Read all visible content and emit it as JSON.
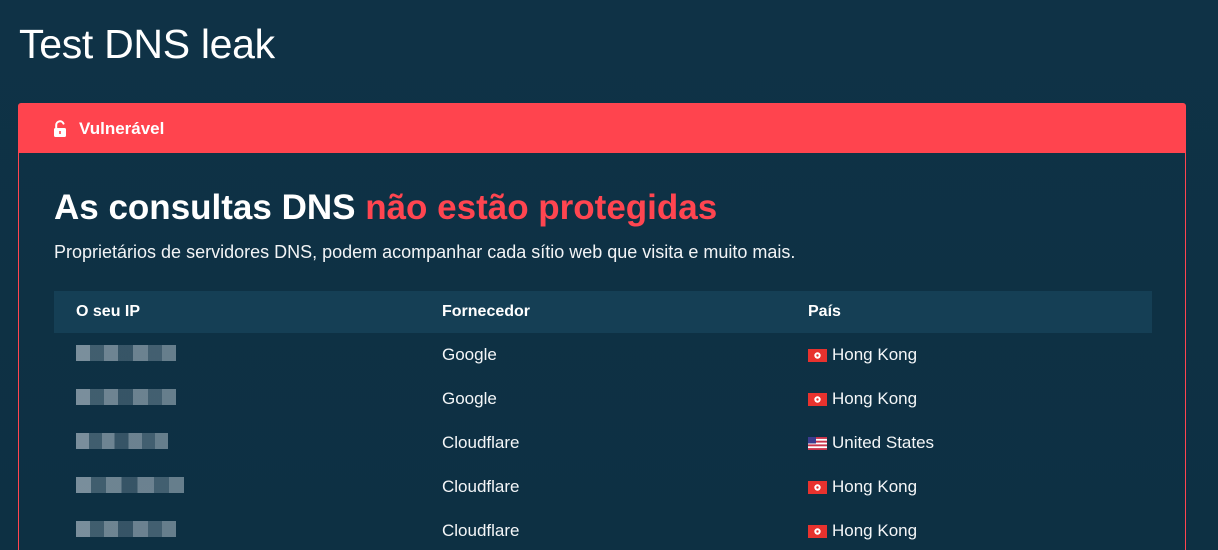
{
  "page": {
    "title": "Test DNS leak"
  },
  "status": {
    "label": "Vulnerável",
    "icon": "unlocked-padlock-icon",
    "color": "#ff444e"
  },
  "headline": {
    "part1": "As consultas DNS ",
    "part2": "não estão protegidas"
  },
  "subtext": "Proprietários de servidores DNS, podem acompanhar cada sítio web que visita e muito mais.",
  "table": {
    "headers": {
      "ip": "O seu IP",
      "provider": "Fornecedor",
      "country": "País"
    },
    "rows": [
      {
        "provider": "Google",
        "country": "Hong Kong",
        "flag": "hong-kong-flag-icon"
      },
      {
        "provider": "Google",
        "country": "Hong Kong",
        "flag": "hong-kong-flag-icon"
      },
      {
        "provider": "Cloudflare",
        "country": "United States",
        "flag": "united-states-flag-icon"
      },
      {
        "provider": "Cloudflare",
        "country": "Hong Kong",
        "flag": "hong-kong-flag-icon"
      },
      {
        "provider": "Cloudflare",
        "country": "Hong Kong",
        "flag": "hong-kong-flag-icon"
      }
    ]
  },
  "colors": {
    "background": "#0e3144",
    "accent": "#ff4550",
    "table_header": "#153f55"
  }
}
